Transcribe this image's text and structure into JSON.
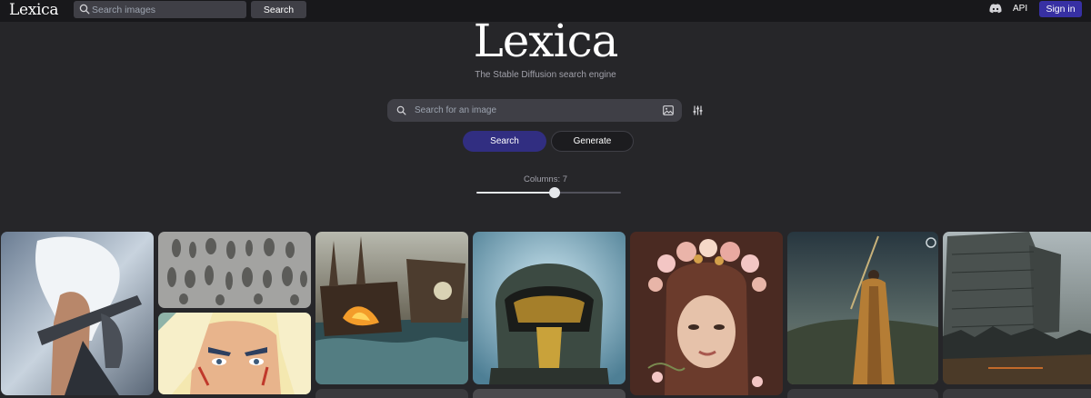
{
  "header": {
    "logo": "Lexica",
    "search_placeholder": "Search images",
    "search_button": "Search",
    "api_label": "API",
    "signin_label": "Sign in"
  },
  "hero": {
    "title": "Lexica",
    "subtitle": "The Stable Diffusion search engine",
    "search_placeholder": "Search for an image",
    "search_button": "Search",
    "generate_button": "Generate"
  },
  "columns": {
    "prefix": "Columns: ",
    "value": "7",
    "slider_fraction": 0.54
  },
  "gallery": [
    {
      "subject": "white-haired-warrior-with-sword"
    },
    {
      "subject": "creature-sketch-sheet"
    },
    {
      "subject": "blonde-anime-character"
    },
    {
      "subject": "burning-pirate-ships"
    },
    {
      "subject": "gold-visor-helmet"
    },
    {
      "subject": "girl-with-flower-crown"
    },
    {
      "subject": "cloaked-figure-with-staff"
    },
    {
      "subject": "dystopian-city-tower"
    }
  ],
  "colors": {
    "page_bg": "#262629",
    "topbar_bg": "#18181b",
    "accent": "#312e81",
    "signin": "#3730a3"
  }
}
